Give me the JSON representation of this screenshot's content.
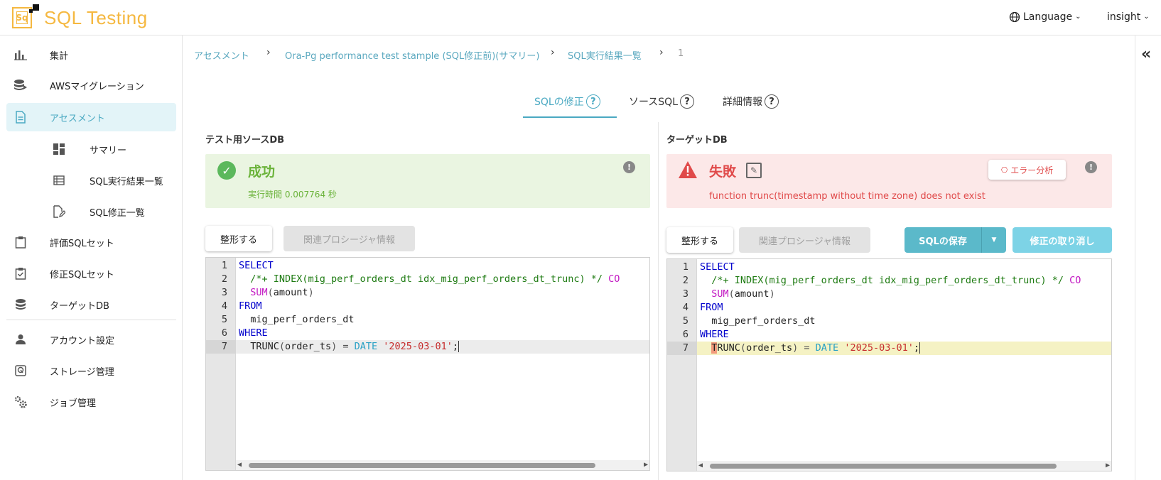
{
  "header": {
    "app_title": "SQL Testing",
    "logo_text": "Sq",
    "language_label": "Language",
    "user_label": "insight"
  },
  "sidebar": {
    "items": [
      {
        "label": "集計",
        "icon": "bar-chart-icon"
      },
      {
        "label": "AWSマイグレーション",
        "icon": "database-migrate-icon"
      },
      {
        "label": "アセスメント",
        "icon": "document-icon",
        "active": true
      },
      {
        "label": "サマリー",
        "icon": "dashboard-icon"
      },
      {
        "label": "SQL実行結果一覧",
        "icon": "table-icon"
      },
      {
        "label": "SQL修正一覧",
        "icon": "edit-document-icon"
      },
      {
        "label": "評価SQLセット",
        "icon": "clipboard-icon"
      },
      {
        "label": "修正SQLセット",
        "icon": "clipboard-check-icon"
      },
      {
        "label": "ターゲットDB",
        "icon": "database-icon"
      },
      {
        "label": "アカウント設定",
        "icon": "person-icon"
      },
      {
        "label": "ストレージ管理",
        "icon": "storage-icon"
      },
      {
        "label": "ジョブ管理",
        "icon": "gears-icon"
      }
    ]
  },
  "breadcrumb": {
    "items": [
      "アセスメント",
      "Ora-Pg performance test stample (SQL修正前)(サマリー)",
      "SQL実行結果一覧"
    ],
    "current": "1"
  },
  "tabs": [
    {
      "label": "SQLの修正",
      "active": true
    },
    {
      "label": "ソースSQL"
    },
    {
      "label": "詳細情報"
    }
  ],
  "left_panel": {
    "title": "テスト用ソースDB",
    "status": "成功",
    "exec_time": "実行時間 0.007764 秒",
    "format_button": "整形する",
    "proc_button": "関連プロシージャ情報"
  },
  "right_panel": {
    "title": "ターゲットDB",
    "status": "失敗",
    "error_message": "function trunc(timestamp without time zone) does not exist",
    "error_analysis_button": "エラー分析",
    "format_button": "整形する",
    "proc_button": "関連プロシージャ情報",
    "save_button": "SQLの保存",
    "cancel_button": "修正の取り消し"
  },
  "sql_lines": [
    "SELECT",
    "  /*+ INDEX(mig_perf_orders_dt idx_mig_perf_orders_dt_trunc) */ CO",
    "  SUM(amount)",
    "FROM",
    "  mig_perf_orders_dt",
    "WHERE",
    "  TRUNC(order_ts) = DATE '2025-03-01';"
  ],
  "colors": {
    "accent": "#4aa9c2",
    "success": "#6bb33a",
    "error": "#e04a4a",
    "brand": "#f5b840"
  }
}
